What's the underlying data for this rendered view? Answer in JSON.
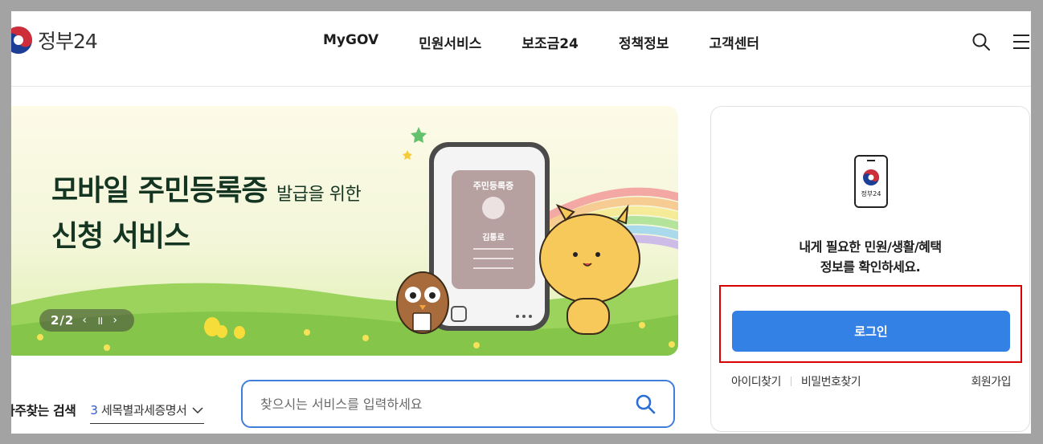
{
  "header": {
    "logo_text": "정부24",
    "nav": [
      "MyGOV",
      "민원서비스",
      "보조금24",
      "정책정보",
      "고객센터"
    ],
    "icons": [
      "search-icon",
      "menu-icon"
    ]
  },
  "banner": {
    "title_line1": "모바일 주민등록증",
    "title_line1_small": "발급을 위한",
    "title_line2": "신청 서비스",
    "card_title": "주민등록증",
    "card_name": "김통로",
    "slide_counter": "2/2",
    "prev_label": "‹",
    "pause_label": "॥",
    "next_label": "›"
  },
  "frequent_search": {
    "label": "자주찾는 검색",
    "number": "3",
    "text": "세목별과세증명서"
  },
  "search": {
    "placeholder": "찾으시는 서비스를 입력하세요"
  },
  "login_card": {
    "phone_label": "정부24",
    "message_line1": "내게 필요한 민원/생활/혜택",
    "message_line2": "정보를 확인하세요.",
    "login_button": "로그인",
    "find_id": "아이디찾기",
    "find_password": "비밀번호찾기",
    "signup": "회원가입"
  },
  "colors": {
    "accent": "#3481e5",
    "highlight_border": "#d90000",
    "search_border": "#3f7fd9",
    "banner_title": "#143521"
  }
}
